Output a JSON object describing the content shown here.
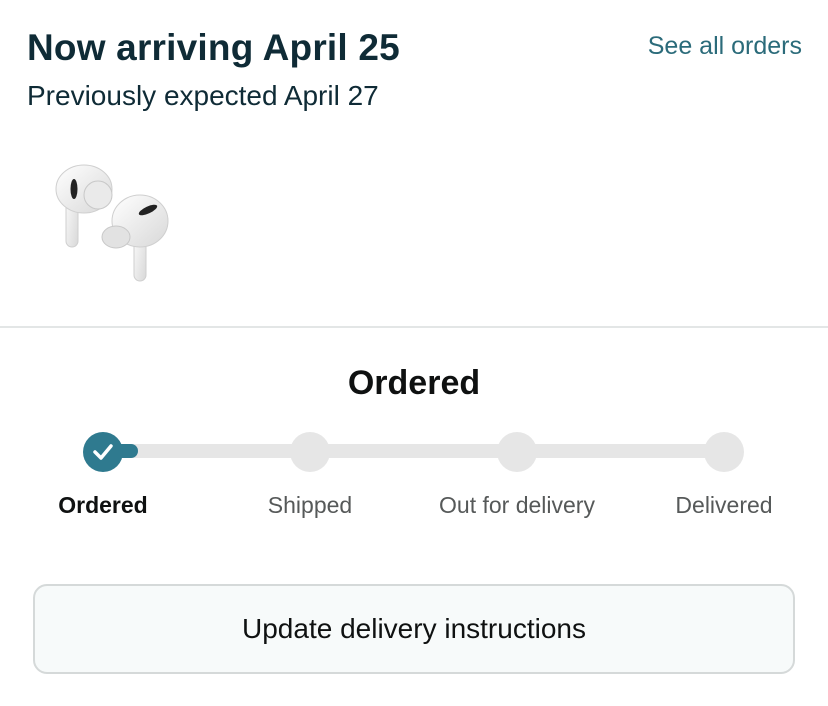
{
  "header": {
    "headline": "Now arriving April 25",
    "subheadline": "Previously expected April 27",
    "see_all_link": "See all orders"
  },
  "product": {
    "icon": "airpods-pro-image"
  },
  "tracker": {
    "status_title": "Ordered",
    "steps": [
      {
        "label": "Ordered",
        "state": "complete"
      },
      {
        "label": "Shipped",
        "state": "pending"
      },
      {
        "label": "Out for delivery",
        "state": "pending"
      },
      {
        "label": "Delivered",
        "state": "pending"
      }
    ],
    "colors": {
      "accent": "#2f7a8f",
      "inactive": "#e6e6e6"
    }
  },
  "actions": {
    "update_label": "Update delivery instructions"
  }
}
